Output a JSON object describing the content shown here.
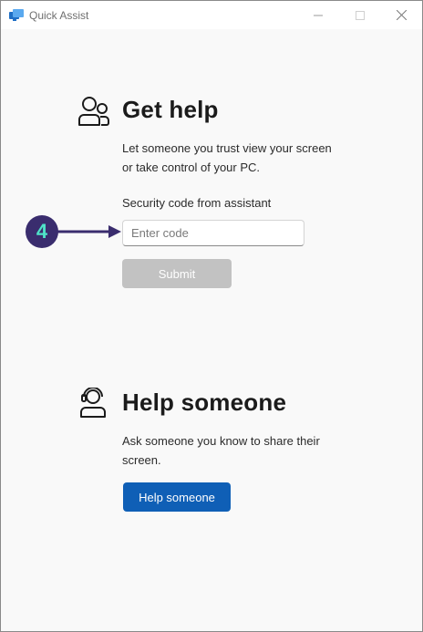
{
  "window": {
    "title": "Quick Assist",
    "controls": [
      "minimize",
      "maximize",
      "close"
    ]
  },
  "get_help": {
    "icon": "people-icon",
    "heading": "Get help",
    "description_line1": "Let someone you trust view your screen",
    "description_line2": "or take control of your PC.",
    "code_label": "Security code from assistant",
    "code_input": {
      "value": "",
      "placeholder": "Enter code"
    },
    "submit_label": "Submit"
  },
  "annotation": {
    "step_number": "4",
    "badge_color": "#3a2d6e",
    "number_color": "#4fe3c8"
  },
  "help_someone": {
    "icon": "person-headset-icon",
    "heading": "Help someone",
    "description_line1": "Ask someone you know to share their",
    "description_line2": "screen.",
    "button_label": "Help someone"
  },
  "colors": {
    "accent": "#0f5fb6",
    "disabled_button": "#c2c2c2",
    "background": "#f9f9f9"
  }
}
